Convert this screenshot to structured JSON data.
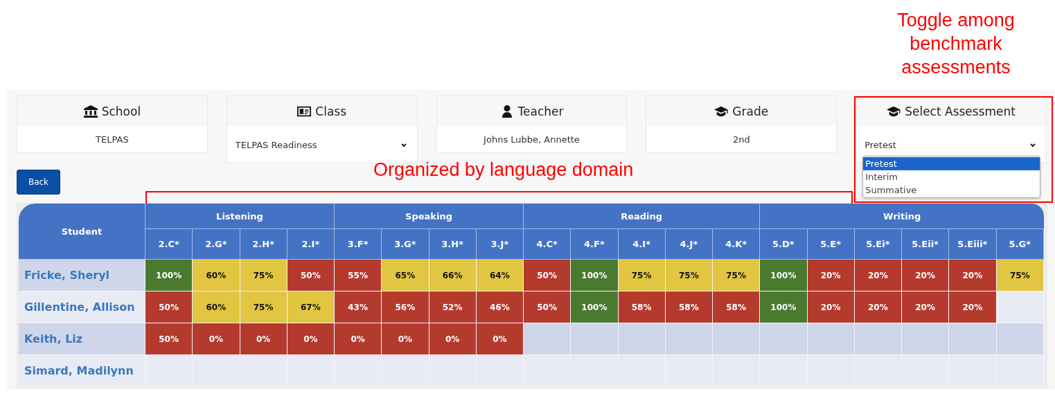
{
  "annotations": [
    {
      "kind": "frame",
      "text": "Toggle among benchmark assessments"
    },
    {
      "kind": "bracket",
      "text": "Organized by language domain"
    }
  ],
  "cards": [
    {
      "kind": "text",
      "title": "School",
      "value": "TELPAS"
    },
    {
      "kind": "select",
      "title": "Class",
      "value": "TELPAS Readiness"
    },
    {
      "kind": "text",
      "title": "Teacher",
      "value": "Johns Lubbe, Annette"
    },
    {
      "kind": "text",
      "title": "Grade",
      "value": "2nd"
    },
    {
      "kind": "select",
      "title": "Select Assessment",
      "value": "Pretest",
      "expanded": true,
      "options": [
        {
          "label": "Pretest",
          "selected": true
        },
        {
          "label": "Interim",
          "selected": false
        },
        {
          "label": "Summative",
          "selected": false
        }
      ]
    }
  ],
  "back_button": "Back",
  "table": {
    "student_heading": "Student",
    "domains": [
      {
        "name": "Listening",
        "columns": [
          "2.C*",
          "2.G*",
          "2.H*",
          "2.I*"
        ]
      },
      {
        "name": "Speaking",
        "columns": [
          "3.F*",
          "3.G*",
          "3.H*",
          "3.J*"
        ]
      },
      {
        "name": "Reading",
        "columns": [
          "4.C*",
          "4.F*",
          "4.I*",
          "4.J*",
          "4.K*"
        ]
      },
      {
        "name": "Writing",
        "columns": [
          "5.D*",
          "5.E*",
          "5.Ei*",
          "5.Eii*",
          "5.Eiii*",
          "5.G*"
        ]
      }
    ],
    "rows": [
      {
        "student": "Fricke, Sheryl",
        "scores": [
          {
            "value": "100%",
            "kind": "high"
          },
          {
            "value": "60%",
            "kind": "mid"
          },
          {
            "value": "75%",
            "kind": "mid"
          },
          {
            "value": "50%",
            "kind": "low"
          },
          {
            "value": "55%",
            "kind": "low"
          },
          {
            "value": "65%",
            "kind": "mid"
          },
          {
            "value": "66%",
            "kind": "mid"
          },
          {
            "value": "64%",
            "kind": "mid"
          },
          {
            "value": "50%",
            "kind": "low"
          },
          {
            "value": "100%",
            "kind": "high"
          },
          {
            "value": "75%",
            "kind": "mid"
          },
          {
            "value": "75%",
            "kind": "mid"
          },
          {
            "value": "75%",
            "kind": "mid"
          },
          {
            "value": "100%",
            "kind": "high"
          },
          {
            "value": "20%",
            "kind": "low"
          },
          {
            "value": "20%",
            "kind": "low"
          },
          {
            "value": "20%",
            "kind": "low"
          },
          {
            "value": "20%",
            "kind": "low"
          },
          {
            "value": "75%",
            "kind": "mid"
          }
        ]
      },
      {
        "student": "Gillentine, Allison",
        "scores": [
          {
            "value": "50%",
            "kind": "low"
          },
          {
            "value": "60%",
            "kind": "mid"
          },
          {
            "value": "75%",
            "kind": "mid"
          },
          {
            "value": "67%",
            "kind": "mid"
          },
          {
            "value": "43%",
            "kind": "low"
          },
          {
            "value": "56%",
            "kind": "low"
          },
          {
            "value": "52%",
            "kind": "low"
          },
          {
            "value": "46%",
            "kind": "low"
          },
          {
            "value": "50%",
            "kind": "low"
          },
          {
            "value": "100%",
            "kind": "high"
          },
          {
            "value": "58%",
            "kind": "low"
          },
          {
            "value": "58%",
            "kind": "low"
          },
          {
            "value": "58%",
            "kind": "low"
          },
          {
            "value": "100%",
            "kind": "high"
          },
          {
            "value": "20%",
            "kind": "low"
          },
          {
            "value": "20%",
            "kind": "low"
          },
          {
            "value": "20%",
            "kind": "low"
          },
          {
            "value": "20%",
            "kind": "low"
          }
        ]
      },
      {
        "student": "Keith, Liz",
        "scores": [
          {
            "value": "50%",
            "kind": "low"
          },
          {
            "value": "0%",
            "kind": "low"
          },
          {
            "value": "0%",
            "kind": "low"
          },
          {
            "value": "0%",
            "kind": "low"
          },
          {
            "value": "0%",
            "kind": "low"
          },
          {
            "value": "0%",
            "kind": "low"
          },
          {
            "value": "0%",
            "kind": "low"
          },
          {
            "value": "0%",
            "kind": "low"
          }
        ]
      },
      {
        "student": "Simard, Madilynn"
      }
    ]
  }
}
